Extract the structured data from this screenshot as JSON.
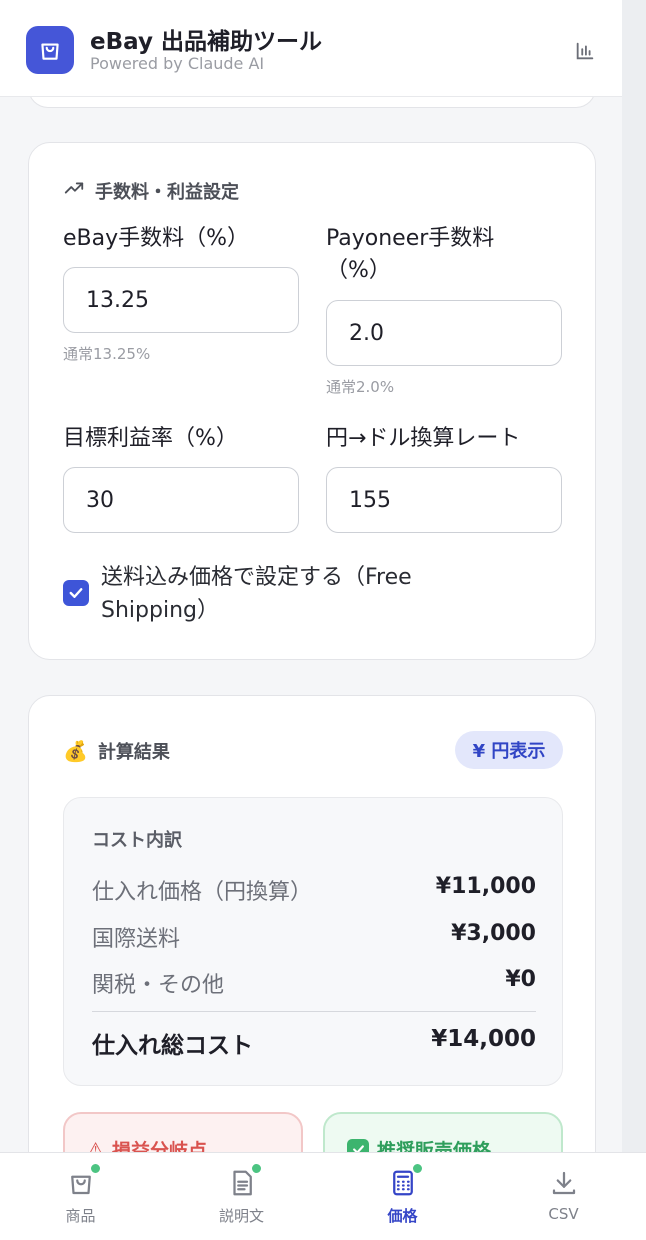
{
  "header": {
    "title": "eBay 出品補助ツール",
    "subtitle": "Powered by Claude AI"
  },
  "fees": {
    "heading": "手数料・利益設定",
    "ebay_fee_label": "eBay手数料（%）",
    "ebay_fee_value": "13.25",
    "ebay_fee_hint": "通常13.25%",
    "payoneer_fee_label": "Payoneer手数料（%）",
    "payoneer_fee_value": "2.0",
    "payoneer_fee_hint": "通常2.0%",
    "target_margin_label": "目標利益率（%）",
    "target_margin_value": "30",
    "fx_rate_label": "円→ドル換算レート",
    "fx_rate_value": "155",
    "free_shipping_label": "送料込み価格で設定する（Free Shipping）",
    "free_shipping_checked": true
  },
  "results": {
    "icon": "money-bag-icon",
    "heading": "計算結果",
    "currency_toggle": "¥ 円表示",
    "cost_breakdown_title": "コスト内訳",
    "rows": [
      {
        "label": "仕入れ価格（円換算）",
        "amount": "¥11,000"
      },
      {
        "label": "国際送料",
        "amount": "¥3,000"
      },
      {
        "label": "関税・その他",
        "amount": "¥0"
      }
    ],
    "total_label": "仕入れ総コスト",
    "total_amount": "¥14,000",
    "break_even_label": "損益分岐点",
    "recommended_label": "推奨販売価格"
  },
  "tabs": [
    {
      "label": "商品",
      "icon": "bag-icon",
      "has_dot": true
    },
    {
      "label": "説明文",
      "icon": "document-icon",
      "has_dot": true
    },
    {
      "label": "価格",
      "icon": "calculator-icon",
      "has_dot": true,
      "active": true
    },
    {
      "label": "CSV",
      "icon": "download-icon",
      "has_dot": false
    }
  ],
  "colors": {
    "accent": "#3e55d8",
    "dot_green": "#4cc482"
  }
}
